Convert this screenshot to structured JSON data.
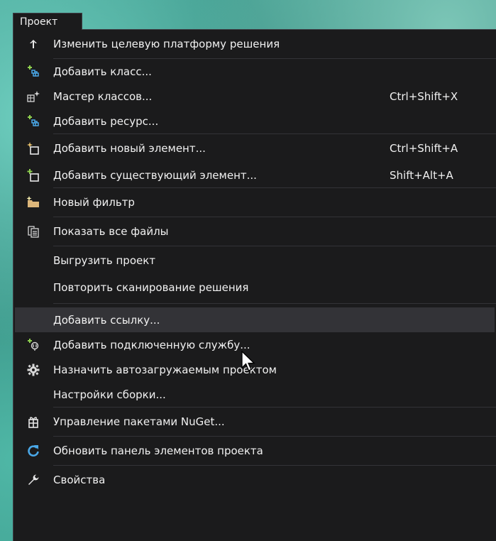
{
  "menu_title": "Проект",
  "items": [
    {
      "label": "Изменить целевую платформу решения",
      "shortcut": "",
      "icon": "arrow-up-icon"
    },
    {
      "label": "Добавить класс...",
      "shortcut": "",
      "icon": "add-class-icon"
    },
    {
      "label": "Мастер классов...",
      "shortcut": "Ctrl+Shift+X",
      "icon": "class-wizard-icon"
    },
    {
      "label": "Добавить ресурс...",
      "shortcut": "",
      "icon": "add-resource-icon"
    },
    {
      "label": "Добавить новый элемент...",
      "shortcut": "Ctrl+Shift+A",
      "icon": "new-item-icon"
    },
    {
      "label": "Добавить существующий элемент...",
      "shortcut": "Shift+Alt+A",
      "icon": "existing-item-icon"
    },
    {
      "label": "Новый фильтр",
      "shortcut": "",
      "icon": "new-filter-folder-icon"
    },
    {
      "label": "Показать все файлы",
      "shortcut": "",
      "icon": "show-all-files-icon"
    },
    {
      "label": "Выгрузить проект",
      "shortcut": "",
      "icon": ""
    },
    {
      "label": "Повторить сканирование решения",
      "shortcut": "",
      "icon": ""
    },
    {
      "label": "Добавить ссылку...",
      "shortcut": "",
      "icon": ""
    },
    {
      "label": "Добавить подключенную службу...",
      "shortcut": "",
      "icon": "connected-service-icon"
    },
    {
      "label": "Назначить автозагружаемым проектом",
      "shortcut": "",
      "icon": "gear-icon"
    },
    {
      "label": "Настройки сборки...",
      "shortcut": "",
      "icon": ""
    },
    {
      "label": "Управление пакетами NuGet...",
      "shortcut": "",
      "icon": "nuget-package-icon"
    },
    {
      "label": "Обновить панель элементов проекта",
      "shortcut": "",
      "icon": "refresh-icon"
    },
    {
      "label": "Свойства",
      "shortcut": "",
      "icon": "wrench-icon"
    }
  ],
  "highlighted_item": "Добавить ссылку...",
  "colors": {
    "menu_bg": "#1b1b1c",
    "highlight_bg": "#333337",
    "text": "#f1f1f1",
    "separator": "#333337",
    "icon_green": "#8fd14f",
    "icon_yellow": "#e8c16b",
    "icon_blue": "#4aa8e8"
  }
}
